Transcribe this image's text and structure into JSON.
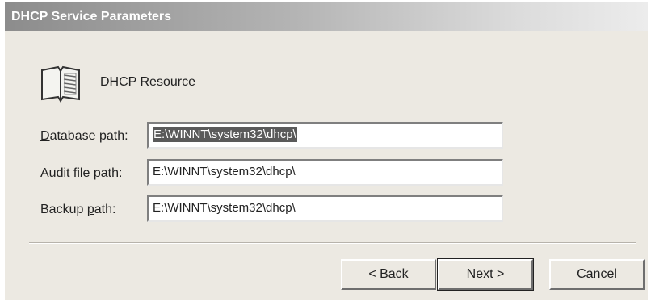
{
  "dialog": {
    "title": "DHCP Service Parameters"
  },
  "resource": {
    "icon": "book-icon",
    "label": "DHCP Resource"
  },
  "fields": {
    "database": {
      "label_prefix": "",
      "label_accel": "D",
      "label_rest": "atabase path:",
      "value": "E:\\WINNT\\system32\\dhcp\\"
    },
    "audit": {
      "label_prefix": "Audit ",
      "label_accel": "f",
      "label_rest": "ile path:",
      "value": "E:\\WINNT\\system32\\dhcp\\"
    },
    "backup": {
      "label_prefix": "Backup ",
      "label_accel": "p",
      "label_rest": "ath:",
      "value": "E:\\WINNT\\system32\\dhcp\\"
    }
  },
  "buttons": {
    "back": {
      "prefix": "< ",
      "accel": "B",
      "rest": "ack"
    },
    "next": {
      "accel": "N",
      "rest": "ext >"
    },
    "cancel": {
      "label": "Cancel"
    }
  },
  "colors": {
    "dialog_bg": "#ece9e2",
    "selection_bg": "#5a5a5a"
  }
}
